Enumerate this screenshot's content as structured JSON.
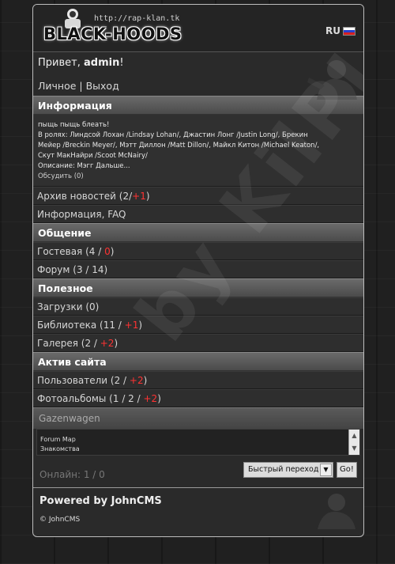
{
  "header": {
    "logo_url": "http://rap-klan.tk",
    "logo_text": "BLACK-HOODS",
    "lang": "RU"
  },
  "user": {
    "greeting": "Привет, ",
    "name": "admin",
    "bang": "!",
    "personal": "Личное",
    "sep": " | ",
    "logout": "Выход"
  },
  "info": {
    "title": "Информация",
    "news_lines": [
      "пыщь пыщь блеать!",
      "В ролях: Линдсой Лохан /Lindsay Lohan/, Джастин Лонг /Justin Long/, Брекин",
      "Мейер /Breckin Meyer/, Мэтт Диллон /Matt Dillon/, Майкл Китон /Michael Keaton/,",
      "Скут МакНайри /Scoot McNairy/",
      "Описание: Мэгг Дальше..."
    ],
    "comment": "Обсудить (0)",
    "archive_label": "Архив новостей (2/",
    "archive_new": "+1",
    "archive_close": ")",
    "faq": "Информация, FAQ"
  },
  "communication": {
    "title": "Общение",
    "guest_label": "Гостевая (4 / ",
    "guest_new": "0",
    "guest_close": ")",
    "forum": "Форум (3 / 14)"
  },
  "useful": {
    "title": "Полезное",
    "downloads": "Загрузки (0)",
    "library_label": "Библиотека (11 / ",
    "library_new": "+1",
    "library_close": ")",
    "gallery_label": "Галерея (2 / ",
    "gallery_new": "+2",
    "gallery_close": ")"
  },
  "activity": {
    "title": "Актив сайта",
    "users_label": "Пользователи (2 / ",
    "users_new": "+2",
    "users_close": ")",
    "albums_label": "Фотоальбомы (1 / 2 / ",
    "albums_new": "+2",
    "albums_close": ")"
  },
  "shoutbox": {
    "title": "Gazenwagen",
    "line1": "Forum Map",
    "line2": "Знакомства"
  },
  "bottom": {
    "online": "Онлайн: 1 / 0",
    "quick_nav": "Быстрый переход",
    "go": "Go!"
  },
  "footer": {
    "powered": "Powered by JohnCMS",
    "copyright": "© JohnCMS"
  },
  "watermark": "by KilPJ"
}
